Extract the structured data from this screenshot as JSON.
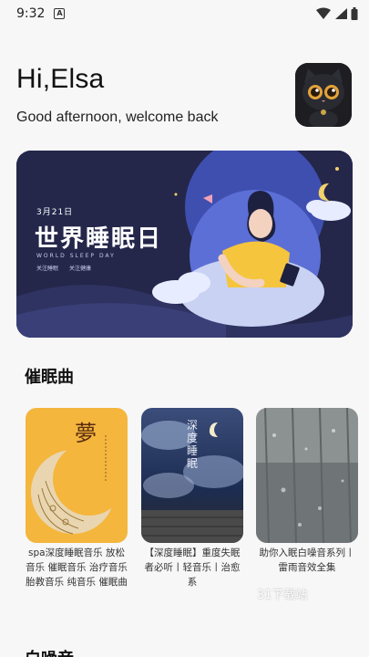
{
  "status": {
    "time": "9:32"
  },
  "header": {
    "title": "Hi,Elsa",
    "subtitle": "Good afternoon, welcome back"
  },
  "banner": {
    "date": "3月21日",
    "title": "世界睡眠日",
    "subtitle_en": "WORLD SLEEP DAY",
    "tag1": "关注睡眠",
    "tag2": "关注健康"
  },
  "sections": {
    "hypnosis": "催眠曲",
    "white_noise": "白噪音"
  },
  "cards": [
    {
      "label": "spa深度睡眠音乐 放松音乐 催眠音乐 治疗音乐 胎教音乐 纯音乐 催眠曲",
      "art_text": "夢"
    },
    {
      "label": "【深度睡眠】重度失眠者必听丨轻音乐丨治愈系",
      "art_text": "深度睡眠"
    },
    {
      "label": "助你入眠白噪音系列丨雷雨音效全集",
      "art_text": ""
    }
  ],
  "watermark": "31下载站",
  "colors": {
    "background": "#f7f7f8",
    "banner_bg": "#24274a",
    "card1_bg": "#f4b63d"
  }
}
